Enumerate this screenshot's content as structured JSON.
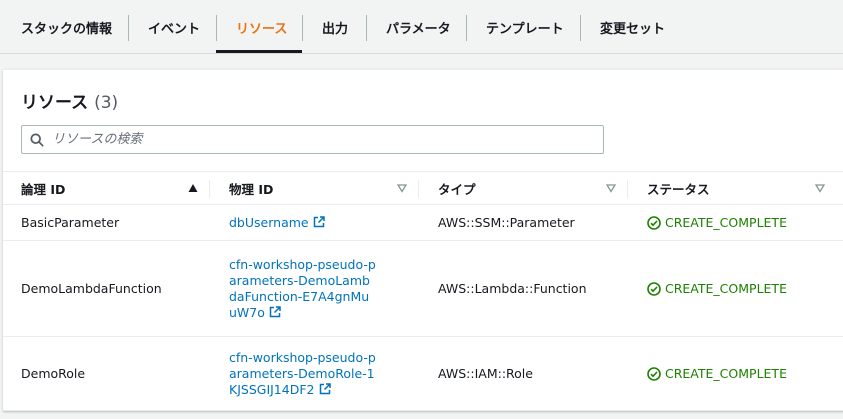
{
  "tabs": [
    {
      "label": "スタックの情報"
    },
    {
      "label": "イベント"
    },
    {
      "label": "リソース"
    },
    {
      "label": "出力"
    },
    {
      "label": "パラメータ"
    },
    {
      "label": "テンプレート"
    },
    {
      "label": "変更セット"
    }
  ],
  "active_tab": "リソース",
  "panel": {
    "title": "リソース",
    "count": "(3)"
  },
  "search": {
    "placeholder": "リソースの検索",
    "value": ""
  },
  "table": {
    "columns": [
      {
        "label": "論理 ID",
        "sort": "ascending"
      },
      {
        "label": "物理 ID",
        "sort": "none"
      },
      {
        "label": "タイプ",
        "sort": "none"
      },
      {
        "label": "ステータス",
        "sort": "none"
      }
    ],
    "rows": [
      {
        "logical_id": "BasicParameter",
        "physical_id": "dbUsername",
        "type": "AWS::SSM::Parameter",
        "status": "CREATE_COMPLETE"
      },
      {
        "logical_id": "DemoLambdaFunction",
        "physical_id": "cfn-workshop-pseudo-parameters-DemoLambdaFunction-E7A4gnMuuW7o",
        "type": "AWS::Lambda::Function",
        "status": "CREATE_COMPLETE"
      },
      {
        "logical_id": "DemoRole",
        "physical_id": "cfn-workshop-pseudo-parameters-DemoRole-1KJSSGIJ14DF2",
        "type": "AWS::IAM::Role",
        "status": "CREATE_COMPLETE"
      }
    ]
  },
  "colors": {
    "active_tab": "#ec7211",
    "link": "#0073bb",
    "success": "#1d8102",
    "text": "#16191f"
  },
  "icons": {
    "search": "search-icon",
    "external_link": "external-link-icon",
    "status_success": "check-circle-icon",
    "sort_ascending": "sort-ascending-icon",
    "sort_none": "sort-down-icon"
  }
}
